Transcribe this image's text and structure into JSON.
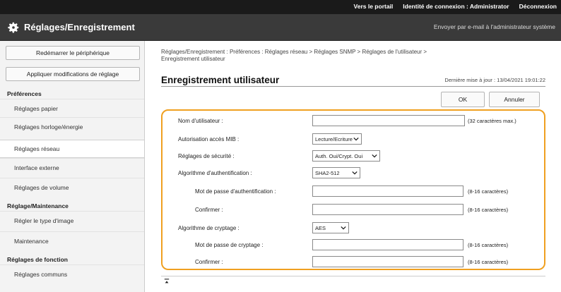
{
  "topbar": {
    "portal": "Vers le portail",
    "login_label": "Identité de connexion : Administrator",
    "logout": "Déconnexion"
  },
  "header": {
    "title": "Réglages/Enregistrement",
    "email_link": "Envoyer par e-mail à l'administrateur système"
  },
  "sidebar": {
    "restart_button": "Redémarrer le périphérique",
    "apply_button": "Appliquer modifications de réglage",
    "sections": [
      {
        "title": "Préférences",
        "items": [
          "Réglages papier",
          "Réglages horloge/énergie",
          "Réglages réseau",
          "Interface externe",
          "Réglages de volume"
        ]
      },
      {
        "title": "Réglage/Maintenance",
        "items": [
          "Régler le type d'image",
          "Maintenance"
        ]
      },
      {
        "title": "Réglages de fonction",
        "items": [
          "Réglages communs"
        ]
      }
    ],
    "active_item": "Réglages réseau"
  },
  "main": {
    "breadcrumb_line1": "Réglages/Enregistrement : Préférences : Réglages réseau > Réglages SNMP > Réglages de l'utilisateur >",
    "breadcrumb_line2": "Enregistrement utilisateur",
    "title": "Enregistrement utilisateur",
    "last_updated": "Dernière mise à jour : 13/04/2021 19:01:22",
    "ok_button": "OK",
    "cancel_button": "Annuler"
  },
  "form": {
    "username_label": "Nom d'utilisateur :",
    "username_value": "",
    "username_hint": "(32 caractères max.)",
    "mib_label": "Autorisation accès MIB :",
    "mib_value": "Lecture/Ecriture",
    "security_label": "Réglages de sécurité :",
    "security_value": "Auth. Oui/Crypt. Oui",
    "auth_algo_label": "Algorithme d'authentification :",
    "auth_algo_value": "SHA2-512",
    "auth_password_label": "Mot de passe d'authentification :",
    "auth_password_hint": "(8-16 caractères)",
    "auth_confirm_label": "Confirmer :",
    "auth_confirm_hint": "(8-16 caractères)",
    "crypt_algo_label": "Algorithme de cryptage :",
    "crypt_algo_value": "AES",
    "crypt_password_label": "Mot de passe de cryptage :",
    "crypt_password_hint": "(8-16 caractères)",
    "crypt_confirm_label": "Confirmer :",
    "crypt_confirm_hint": "(8-16 caractères)"
  },
  "colors": {
    "highlight": "#f0a020",
    "header": "#3a3a3a",
    "topbar": "#1a1a1a"
  }
}
